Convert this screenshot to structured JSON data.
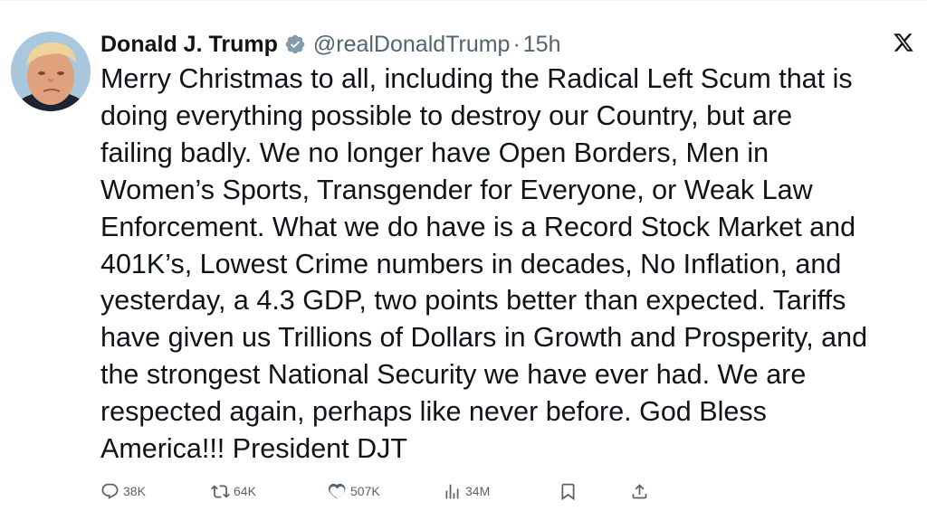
{
  "author": {
    "display_name": "Donald J. Trump",
    "handle": "@realDonaldTrump",
    "separator": "·",
    "time": "15h"
  },
  "tweet": {
    "text": "Merry Christmas to all, including the Radical Left Scum that is\ndoing everything possible to destroy our Country, but are\nfailing badly. We no longer have Open Borders, Men in\nWomen’s Sports, Transgender for Everyone, or Weak Law\nEnforcement. What we do have is a Record Stock Market and\n401K’s, Lowest Crime numbers in decades, No Inflation, and\nyesterday, a 4.3 GDP, two points better than expected. Tariffs\nhave given us Trillions of Dollars in Growth and Prosperity, and\nthe strongest National Security we have ever had. We are\nrespected again, perhaps like never before. God Bless\nAmerica!!! President DJT"
  },
  "actions": {
    "replies": "38K",
    "reposts": "64K",
    "likes": "507K",
    "views": "34M"
  },
  "icons": {
    "verified": "verified-badge-icon",
    "platform": "x-logo-icon",
    "reply": "reply-icon",
    "repost": "repost-icon",
    "like": "heart-icon",
    "views": "views-chart-icon",
    "bookmark": "bookmark-icon",
    "share": "share-icon"
  },
  "colors": {
    "text_primary": "#0f1419",
    "text_secondary": "#536471",
    "verified_badge": "#829aab"
  }
}
